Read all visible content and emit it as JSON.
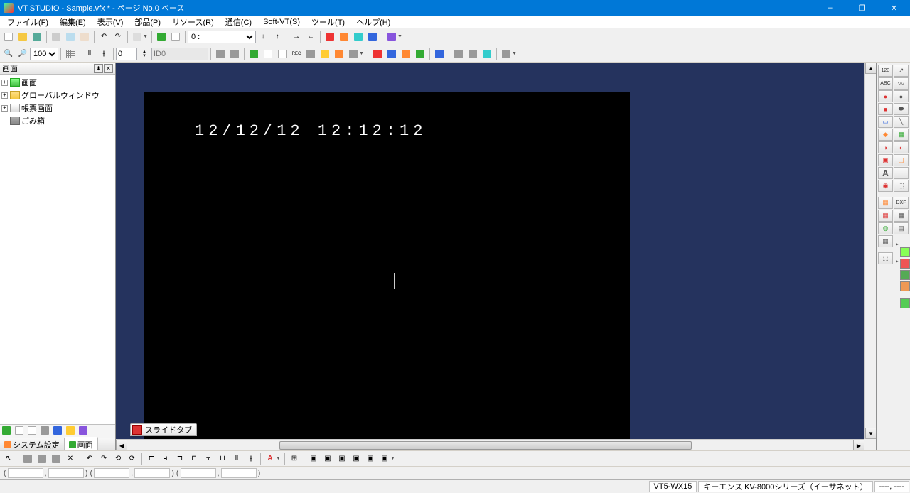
{
  "window": {
    "title": "VT STUDIO - Sample.vfx * - ページ No.0 ベース",
    "minimize": "–",
    "maximize": "❐",
    "close": "✕"
  },
  "menu": {
    "file": "ファイル(F)",
    "edit": "編集(E)",
    "view": "表示(V)",
    "parts": "部品(P)",
    "resource": "リソース(R)",
    "comm": "通信(C)",
    "softvt": "Soft-VT(S)",
    "tool": "ツール(T)",
    "help": "ヘルプ(H)"
  },
  "toolbar1": {
    "page_value": "0 :",
    "zoom_value": "100%",
    "num_value": "0",
    "id_placeholder": "ID0"
  },
  "tree": {
    "panel_title": "画面",
    "items": [
      {
        "expand": "+",
        "icon": "check",
        "label": "画面"
      },
      {
        "expand": "+",
        "icon": "folder",
        "label": "グローバルウィンドウ"
      },
      {
        "expand": "+",
        "icon": "page",
        "label": "帳票画面"
      },
      {
        "expand": "",
        "icon": "trash",
        "label": "ごみ箱"
      }
    ],
    "tabs": {
      "system": "システム設定",
      "screen": "画面"
    }
  },
  "canvas": {
    "datetime_text": "12/12/12 12:12:12",
    "slide_tab_label": "スライドタブ"
  },
  "right_tools": {
    "r1": [
      "123",
      "↗"
    ],
    "r2": [
      "ABC",
      "〰"
    ],
    "r3": [
      "●",
      "●"
    ],
    "r4": [
      "■",
      "⬬"
    ],
    "r5": [
      "▭",
      "╲"
    ],
    "r6": [
      "◆",
      "▦"
    ],
    "r7": [
      "◑",
      "◐"
    ],
    "r8": [
      "▣",
      "▢"
    ],
    "r9": [
      "A",
      ""
    ],
    "r10": [
      "◉",
      "⬚"
    ],
    "r11": [
      "▦",
      "DXF"
    ],
    "r12": [
      "▦",
      "▦"
    ],
    "r13": [
      "◍",
      "▤"
    ],
    "r14": [
      "▦",
      ""
    ],
    "r15": [
      "⬚",
      ""
    ]
  },
  "statusbar": {
    "model": "VT5-WX15",
    "device": "キーエンス KV-8000シリーズ（イーサネット）",
    "coords": "----, ----"
  },
  "coord_bar": {
    "p1": "(",
    "p2": ",",
    "p3": ")  (",
    "p4": ",",
    "p5": ")  (",
    "p6": ",",
    "p7": ")"
  }
}
